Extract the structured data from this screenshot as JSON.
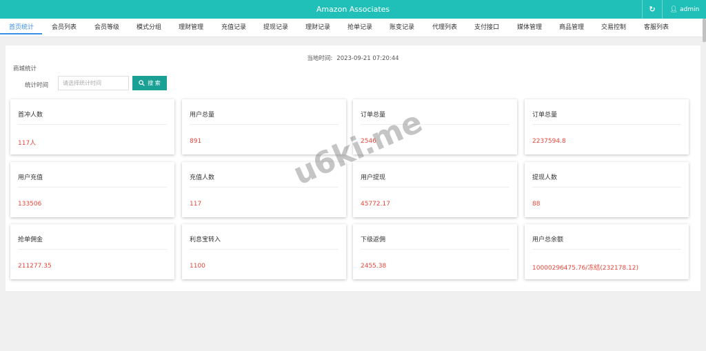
{
  "header": {
    "app_title": "Amazon Associates",
    "username": "admin"
  },
  "tabs": [
    "首页统计",
    "会员列表",
    "会员等级",
    "模式分组",
    "理财管理",
    "充值记录",
    "提现记录",
    "理财记录",
    "抢单记录",
    "账变记录",
    "代理列表",
    "支付接口",
    "媒体管理",
    "商品管理",
    "交易控制",
    "客服列表"
  ],
  "main": {
    "local_time_label": "当地时间:",
    "local_time_value": "2023-09-21 07:20:44",
    "section_label": "商城统计",
    "filter_label": "统计时间",
    "date_placeholder": "请选择统计时间",
    "search_label": "搜 索"
  },
  "cards": [
    {
      "title": "首冲人数",
      "value": "117人"
    },
    {
      "title": "用户总量",
      "value": "891"
    },
    {
      "title": "订单总量",
      "value": "2546"
    },
    {
      "title": "订单总量",
      "value": "2237594.8"
    },
    {
      "title": "用户充值",
      "value": "133506"
    },
    {
      "title": "充值人数",
      "value": "117"
    },
    {
      "title": "用户提现",
      "value": "45772.17"
    },
    {
      "title": "提现人数",
      "value": "88"
    },
    {
      "title": "抢单佣金",
      "value": "211277.35"
    },
    {
      "title": "利息宝转入",
      "value": "1100"
    },
    {
      "title": "下级返佣",
      "value": "2455.38"
    },
    {
      "title": "用户总余额",
      "value": "10000296475.76/冻结(232178.12)"
    }
  ],
  "watermark": "u6ki.me",
  "colors": {
    "header": "#20c0b8",
    "active_tab": "#3a8ee6",
    "button": "#1aa094",
    "value": "#e6463a"
  },
  "icons": {
    "refresh": "refresh-icon",
    "user": "user-icon",
    "search": "search-icon"
  }
}
